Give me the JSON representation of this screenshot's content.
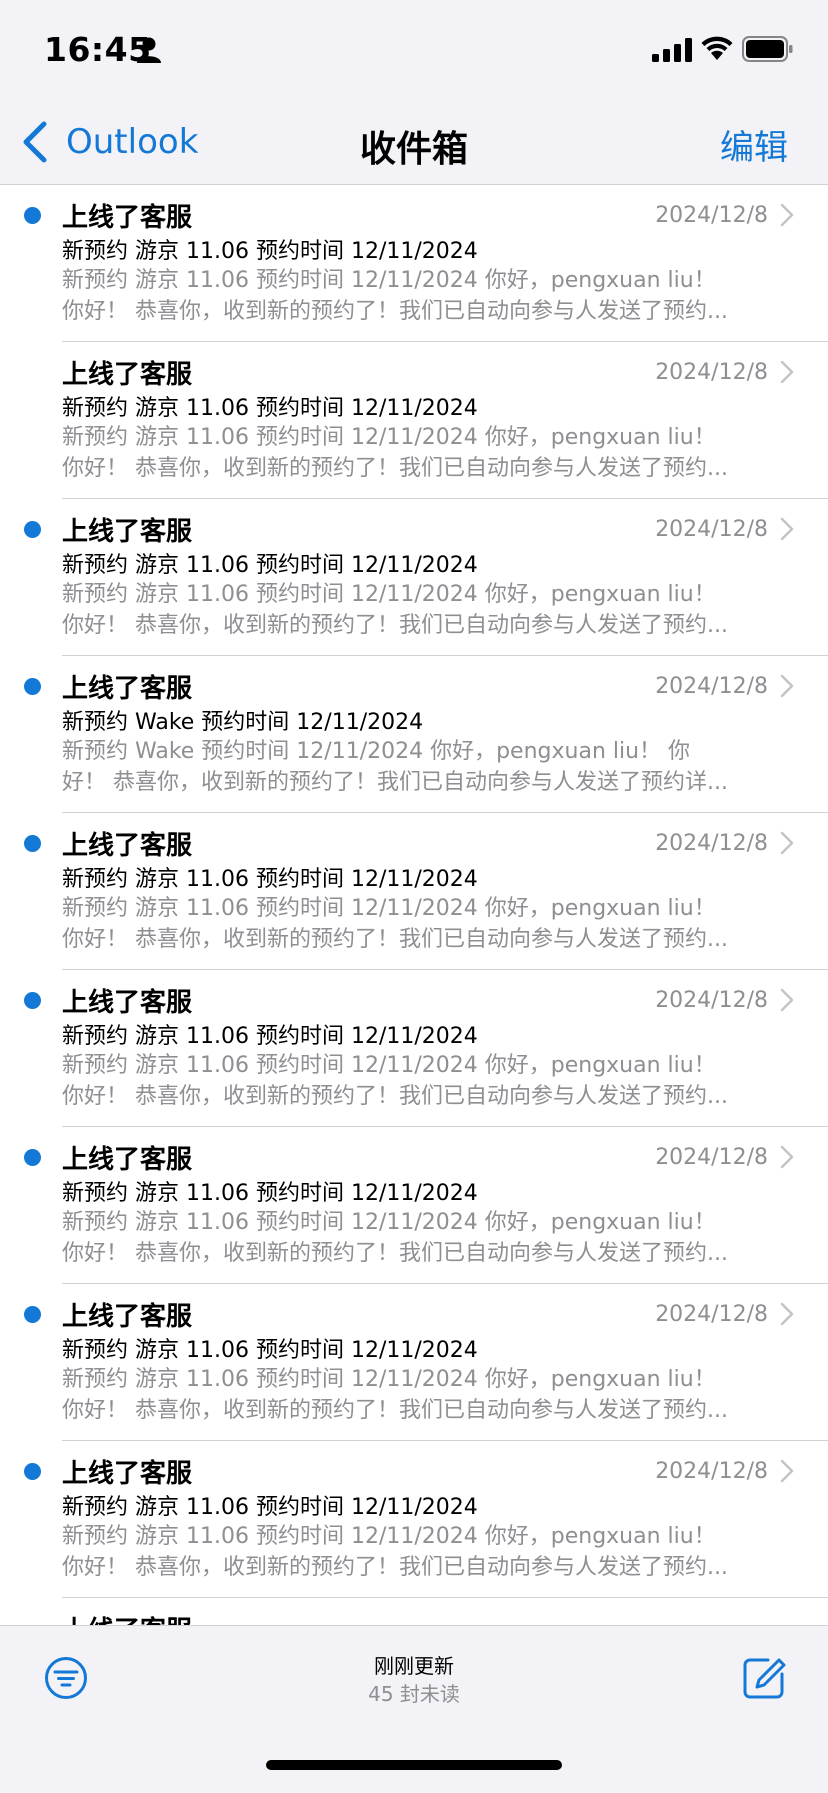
{
  "status_bar": {
    "time": "16:45",
    "icons": [
      "person-icon",
      "signal-icon",
      "wifi-icon",
      "battery-icon"
    ]
  },
  "nav": {
    "back_label": "Outlook",
    "title": "收件箱",
    "edit_label": "编辑"
  },
  "colors": {
    "accent": "#1479d6",
    "secondary_text": "#8e8e93",
    "bar_background": "#f2f2f7",
    "separator": "#d1d1d6"
  },
  "messages": [
    {
      "unread": true,
      "sender": "上线了客服",
      "date": "2024/12/8",
      "subject": "新预约 游京 11.06 预约时间 12/11/2024",
      "preview_line1": "新预约 游京 11.06 预约时间 12/11/2024 你好，pengxuan liu！",
      "preview_line2": "你好！ 恭喜你，收到新的预约了！我们已自动向参与人发送了预约..."
    },
    {
      "unread": false,
      "sender": "上线了客服",
      "date": "2024/12/8",
      "subject": "新预约 游京 11.06 预约时间 12/11/2024",
      "preview_line1": "新预约 游京 11.06 预约时间 12/11/2024 你好，pengxuan liu！",
      "preview_line2": "你好！ 恭喜你，收到新的预约了！我们已自动向参与人发送了预约..."
    },
    {
      "unread": true,
      "sender": "上线了客服",
      "date": "2024/12/8",
      "subject": "新预约 游京 11.06 预约时间 12/11/2024",
      "preview_line1": "新预约 游京 11.06 预约时间 12/11/2024 你好，pengxuan liu！",
      "preview_line2": "你好！ 恭喜你，收到新的预约了！我们已自动向参与人发送了预约..."
    },
    {
      "unread": true,
      "sender": "上线了客服",
      "date": "2024/12/8",
      "subject": "新预约 Wake 预约时间 12/11/2024",
      "preview_line1": "新预约 Wake 预约时间 12/11/2024 你好，pengxuan liu！ 你",
      "preview_line2": "好！ 恭喜你，收到新的预约了！我们已自动向参与人发送了预约详..."
    },
    {
      "unread": true,
      "sender": "上线了客服",
      "date": "2024/12/8",
      "subject": "新预约 游京 11.06 预约时间 12/11/2024",
      "preview_line1": "新预约 游京 11.06 预约时间 12/11/2024 你好，pengxuan liu！",
      "preview_line2": "你好！ 恭喜你，收到新的预约了！我们已自动向参与人发送了预约..."
    },
    {
      "unread": true,
      "sender": "上线了客服",
      "date": "2024/12/8",
      "subject": "新预约 游京 11.06 预约时间 12/11/2024",
      "preview_line1": "新预约 游京 11.06 预约时间 12/11/2024 你好，pengxuan liu！",
      "preview_line2": "你好！ 恭喜你，收到新的预约了！我们已自动向参与人发送了预约..."
    },
    {
      "unread": true,
      "sender": "上线了客服",
      "date": "2024/12/8",
      "subject": "新预约 游京 11.06 预约时间 12/11/2024",
      "preview_line1": "新预约 游京 11.06 预约时间 12/11/2024 你好，pengxuan liu！",
      "preview_line2": "你好！ 恭喜你，收到新的预约了！我们已自动向参与人发送了预约..."
    },
    {
      "unread": true,
      "sender": "上线了客服",
      "date": "2024/12/8",
      "subject": "新预约 游京 11.06 预约时间 12/11/2024",
      "preview_line1": "新预约 游京 11.06 预约时间 12/11/2024 你好，pengxuan liu！",
      "preview_line2": "你好！ 恭喜你，收到新的预约了！我们已自动向参与人发送了预约..."
    },
    {
      "unread": true,
      "sender": "上线了客服",
      "date": "2024/12/8",
      "subject": "新预约 游京 11.06 预约时间 12/11/2024",
      "preview_line1": "新预约 游京 11.06 预约时间 12/11/2024 你好，pengxuan liu！",
      "preview_line2": "你好！ 恭喜你，收到新的预约了！我们已自动向参与人发送了预约..."
    },
    {
      "unread": false,
      "sender": "上线了客服",
      "date": "",
      "subject": "",
      "preview_line1": "",
      "preview_line2": ""
    }
  ],
  "toolbar": {
    "update_status": "刚刚更新",
    "unread_count": "45 封未读",
    "icons": [
      "filter-icon",
      "compose-icon"
    ]
  }
}
